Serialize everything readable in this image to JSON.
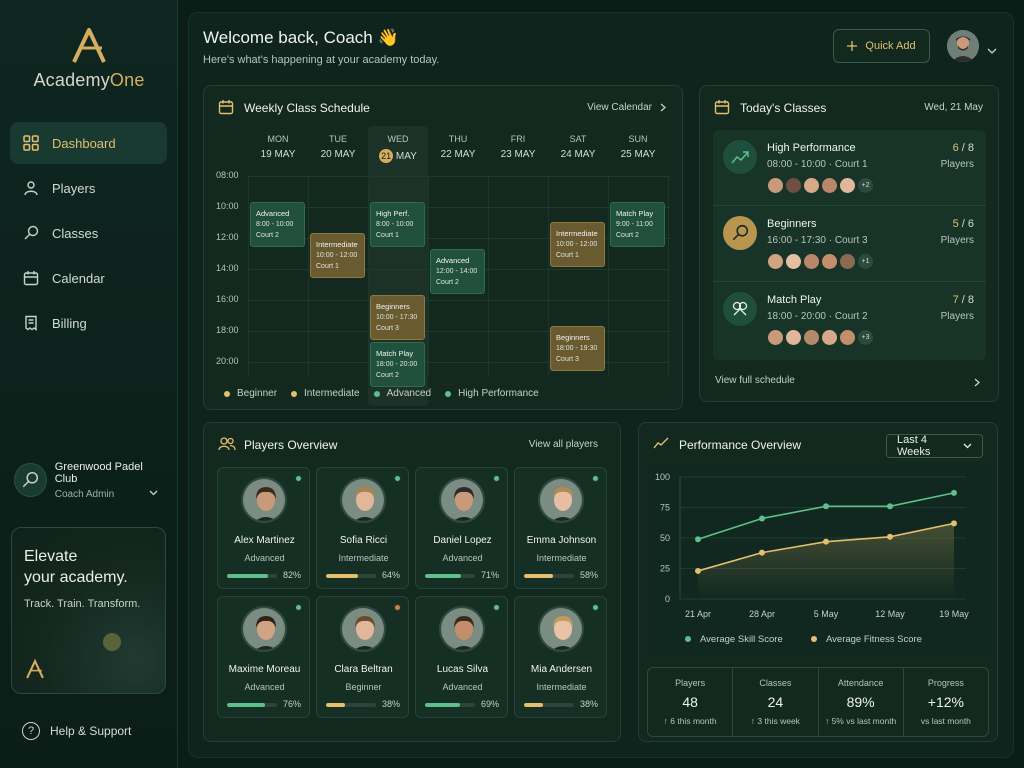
{
  "brand": {
    "name_a": "Academy",
    "name_b": "One"
  },
  "nav": [
    {
      "label": "Dashboard",
      "icon": "grid-icon",
      "active": true
    },
    {
      "label": "Players",
      "icon": "user-icon"
    },
    {
      "label": "Classes",
      "icon": "racket-icon"
    },
    {
      "label": "Calendar",
      "icon": "calendar-icon"
    },
    {
      "label": "Billing",
      "icon": "receipt-icon"
    }
  ],
  "club": {
    "name": "Greenwood Padel Club",
    "role": "Coach Admin"
  },
  "promo": {
    "line1": "Elevate",
    "line2": "your academy.",
    "tagline": "Track. Train. Transform."
  },
  "help": {
    "label": "Help & Support"
  },
  "header": {
    "welcome": "Welcome back, Coach 👋",
    "subtitle": "Here's what's happening at your academy today.",
    "quick_add": "Quick Add"
  },
  "schedule": {
    "title": "Weekly Class Schedule",
    "link": "View Calendar",
    "days": [
      {
        "name": "MON",
        "date": "19 MAY"
      },
      {
        "name": "TUE",
        "date": "20 MAY"
      },
      {
        "name": "WED",
        "date_num": "21",
        "date": "MAY",
        "today": true
      },
      {
        "name": "THU",
        "date": "22 MAY"
      },
      {
        "name": "FRI",
        "date": "23 MAY"
      },
      {
        "name": "SAT",
        "date": "24 MAY"
      },
      {
        "name": "SUN",
        "date": "25 MAY"
      }
    ],
    "times": [
      "08:00",
      "10:00",
      "12:00",
      "14:00",
      "16:00",
      "18:00",
      "20:00"
    ],
    "events": [
      {
        "day": 0,
        "start": 10,
        "title": "Advanced",
        "time": "8:00 - 10:00",
        "court": "Court 2",
        "level": "adv"
      },
      {
        "day": 1,
        "start": 12,
        "title": "Intermediate",
        "time": "10:00 - 12:00",
        "court": "Court 1",
        "level": "int"
      },
      {
        "day": 2,
        "start": 10,
        "title": "High Perf.",
        "time": "8:00 - 10:00",
        "court": "Court 1",
        "level": "hp"
      },
      {
        "day": 2,
        "start": 16,
        "title": "Beginners",
        "time": "10:00 - 17:30",
        "court": "Court 3",
        "level": "beg"
      },
      {
        "day": 2,
        "start": 19,
        "title": "Match Play",
        "time": "18:00 - 20:00",
        "court": "Court 2",
        "level": "adv"
      },
      {
        "day": 3,
        "start": 13,
        "title": "Advanced",
        "time": "12:00 - 14:00",
        "court": "Court 2",
        "level": "adv"
      },
      {
        "day": 5,
        "start": 11.3,
        "title": "Intermediate",
        "time": "10:00 - 12:00",
        "court": "Court 1",
        "level": "int"
      },
      {
        "day": 5,
        "start": 18,
        "title": "Beginners",
        "time": "18:00 - 19:30",
        "court": "Court 3",
        "level": "beg"
      },
      {
        "day": 6,
        "start": 10,
        "title": "Match Play",
        "time": "9:00 - 11:00",
        "court": "Court 2",
        "level": "adv"
      }
    ],
    "legend": [
      {
        "label": "Beginner",
        "color": "#e3bf6e"
      },
      {
        "label": "Intermediate",
        "color": "#e3bf6e"
      },
      {
        "label": "Advanced",
        "color": "#5fbf8a"
      },
      {
        "label": "High Performance",
        "color": "#5fbf8a"
      }
    ]
  },
  "today": {
    "title": "Today's Classes",
    "date": "Wed, 21 May",
    "classes": [
      {
        "name": "High Performance",
        "time": "08:00 - 10:00 · Court 1",
        "count": "6",
        "max": " / 8",
        "players_label": "Players",
        "more": "+2",
        "icon": "chart-up-icon",
        "icon_bg": "#1f4f3c"
      },
      {
        "name": "Beginners",
        "time": "16:00 - 17:30 · Court 3",
        "count": "5",
        "max": " / 6",
        "players_label": "Players",
        "more": "+1",
        "icon": "racket-icon",
        "icon_bg": "#b89650"
      },
      {
        "name": "Match Play",
        "time": "18:00 - 20:00 · Court 2",
        "count": "7",
        "max": " / 8",
        "players_label": "Players",
        "more": "+3",
        "icon": "crossed-rackets-icon",
        "icon_bg": "#1f4f3c"
      }
    ],
    "view_full": "View full schedule"
  },
  "players": {
    "title": "Players Overview",
    "link": "View all players",
    "list": [
      {
        "name": "Alex Martinez",
        "level": "Advanced",
        "pct": "82%",
        "value": 82,
        "bar": "#5fbf8a",
        "status": "#5fbf8a",
        "hair": "#3b2a20",
        "skin": "#c99a7a"
      },
      {
        "name": "Sofia Ricci",
        "level": "Intermediate",
        "pct": "64%",
        "value": 64,
        "bar": "#e3bf6e",
        "status": "#5fbf8a",
        "hair": "#a7834f",
        "skin": "#e0b79a"
      },
      {
        "name": "Daniel Lopez",
        "level": "Advanced",
        "pct": "71%",
        "value": 71,
        "bar": "#5fbf8a",
        "status": "#5fbf8a",
        "hair": "#2b2b2b",
        "skin": "#c99a7a"
      },
      {
        "name": "Emma Johnson",
        "level": "Intermediate",
        "pct": "58%",
        "value": 58,
        "bar": "#e3bf6e",
        "status": "#5fbf8a",
        "hair": "#b08b55",
        "skin": "#e6bea1"
      },
      {
        "name": "Maxime Moreau",
        "level": "Advanced",
        "pct": "76%",
        "value": 76,
        "bar": "#5fbf8a",
        "status": "#5fbf8a",
        "hair": "#2f2218",
        "skin": "#d2a383"
      },
      {
        "name": "Clara Beltran",
        "level": "Beginner",
        "pct": "38%",
        "value": 38,
        "bar": "#e3bf6e",
        "status": "#d9793c",
        "hair": "#6b4a30",
        "skin": "#e0b79a"
      },
      {
        "name": "Lucas Silva",
        "level": "Advanced",
        "pct": "69%",
        "value": 69,
        "bar": "#5fbf8a",
        "status": "#5fbf8a",
        "hair": "#3a2a1e",
        "skin": "#c48e6c"
      },
      {
        "name": "Mia Andersen",
        "level": "Intermediate",
        "pct": "38%",
        "value": 38,
        "bar": "#e3bf6e",
        "status": "#5fbf8a",
        "hair": "#c49b5e",
        "skin": "#e8c3a6"
      }
    ]
  },
  "performance": {
    "title": "Performance Overview",
    "range": "Last 4 Weeks",
    "stats": [
      {
        "label": "Players",
        "value": "48",
        "note": "↑ 6 this month"
      },
      {
        "label": "Classes",
        "value": "24",
        "note": "↑ 3 this week"
      },
      {
        "label": "Attendance",
        "value": "89%",
        "note": "↑ 5% vs last month"
      },
      {
        "label": "Progress",
        "value": "+12%",
        "note": "vs last month"
      }
    ]
  },
  "chart_data": {
    "type": "line",
    "x": [
      "21 Apr",
      "28 Apr",
      "5 May",
      "12 May",
      "19 May"
    ],
    "ylim": [
      0,
      100
    ],
    "yticks": [
      0,
      25,
      50,
      75,
      100
    ],
    "grid": true,
    "legend": "bottom",
    "series": [
      {
        "name": "Average Skill Score",
        "color": "#5fbf8a",
        "values": [
          49,
          66,
          76,
          76,
          87
        ]
      },
      {
        "name": "Average Fitness Score",
        "color": "#e3bf6e",
        "values": [
          23,
          38,
          47,
          51,
          62
        ]
      }
    ]
  }
}
